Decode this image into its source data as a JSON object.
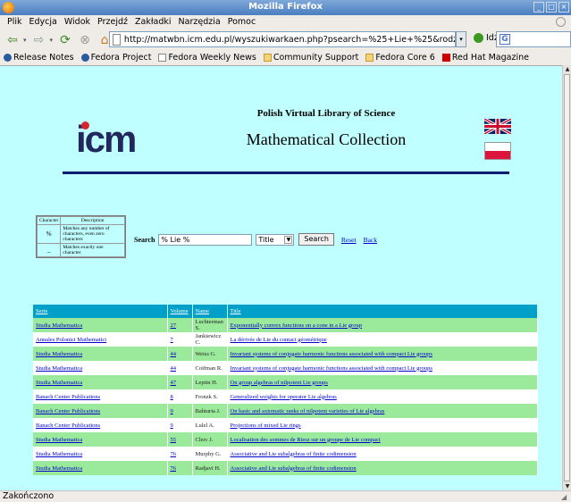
{
  "window": {
    "title": "Mozilla Firefox"
  },
  "menu": [
    "Plik",
    "Edycja",
    "Widok",
    "Przejdź",
    "Zakładki",
    "Narzędzia",
    "Pomoc"
  ],
  "toolbar": {
    "url": "http://matwbn.icm.edu.pl/wyszukiwarkaen.php?psearch=%25+Lie+%25&rodzaj=Title&Submit=Sear",
    "go_label": "Idź",
    "search_value": ""
  },
  "bookmarks": [
    {
      "label": "Release Notes",
      "icon": "fedora-icon"
    },
    {
      "label": "Fedora Project",
      "icon": "fedora-icon"
    },
    {
      "label": "Fedora Weekly News",
      "icon": "page-icon"
    },
    {
      "label": "Community Support",
      "icon": "folder-icon"
    },
    {
      "label": "Fedora Core 6",
      "icon": "folder-icon"
    },
    {
      "label": "Red Hat Magazine",
      "icon": "redhat-icon"
    }
  ],
  "page": {
    "logo_text": "icm",
    "subtitle": "Polish Virtual Library of Science",
    "title": "Mathematical Collection",
    "legend": {
      "headers": [
        "Character",
        "Description"
      ],
      "rows": [
        {
          "char": "%",
          "desc": "Matches any number of characters, even zero characters"
        },
        {
          "char": "_",
          "desc": "Matches exactly one character"
        }
      ]
    },
    "search": {
      "label": "Search",
      "value": "% Lie %",
      "field": "Title",
      "button": "Search",
      "reset": "Reset",
      "back": "Back"
    },
    "columns": [
      "Serie",
      "Volume",
      "Name",
      "Title"
    ],
    "rows": [
      {
        "serie": "Studia Mathematica",
        "volume": "27",
        "name": "Luchterman S.",
        "title": "Exponentially convex functions on a cone in a Lie group"
      },
      {
        "serie": "Annales Polonici Mathematici",
        "volume": "7",
        "name": "Jankiewicz C.",
        "title": "La dérivée de Lie du contact géométrique"
      },
      {
        "serie": "Studia Mathematica",
        "volume": "44",
        "name": "Weiss G.",
        "title": "Invariant systems of conjugate harmonic functions associated with compact Lie groups"
      },
      {
        "serie": "Studia Mathematica",
        "volume": "44",
        "name": "Coifman R.",
        "title": "Invariant systems of conjugate harmonic functions associated with compact Lie groups"
      },
      {
        "serie": "Studia Mathematica",
        "volume": "47",
        "name": "Leptin H.",
        "title": "On group algebras of nilpotent Lie groups"
      },
      {
        "serie": "Banach Center Publications",
        "volume": "8",
        "name": "Fronzk S.",
        "title": "Generalized weights for operator Lie algebras"
      },
      {
        "serie": "Banach Center Publications",
        "volume": "9",
        "name": "Bahturia J.",
        "title": "On basic and axiomatic ranks of nilpotent varieties of Lie algebras"
      },
      {
        "serie": "Banach Center Publications",
        "volume": "9",
        "name": "Lulel A.",
        "title": "Projections of mixed Lie rings"
      },
      {
        "serie": "Studia Mathematica",
        "volume": "55",
        "name": "Clerc J.",
        "title": "Localisation des sommes de Riesz sur un groupe de Lie compact"
      },
      {
        "serie": "Studia Mathematica",
        "volume": "76",
        "name": "Murphy G.",
        "title": "Associative and Lie subalgebras of finite codimension"
      },
      {
        "serie": "Studia Mathematica",
        "volume": "76",
        "name": "Radjavi H.",
        "title": "Associative and Lie subalgebras of finite codimension"
      }
    ]
  },
  "status": {
    "text": "Zakończono"
  }
}
